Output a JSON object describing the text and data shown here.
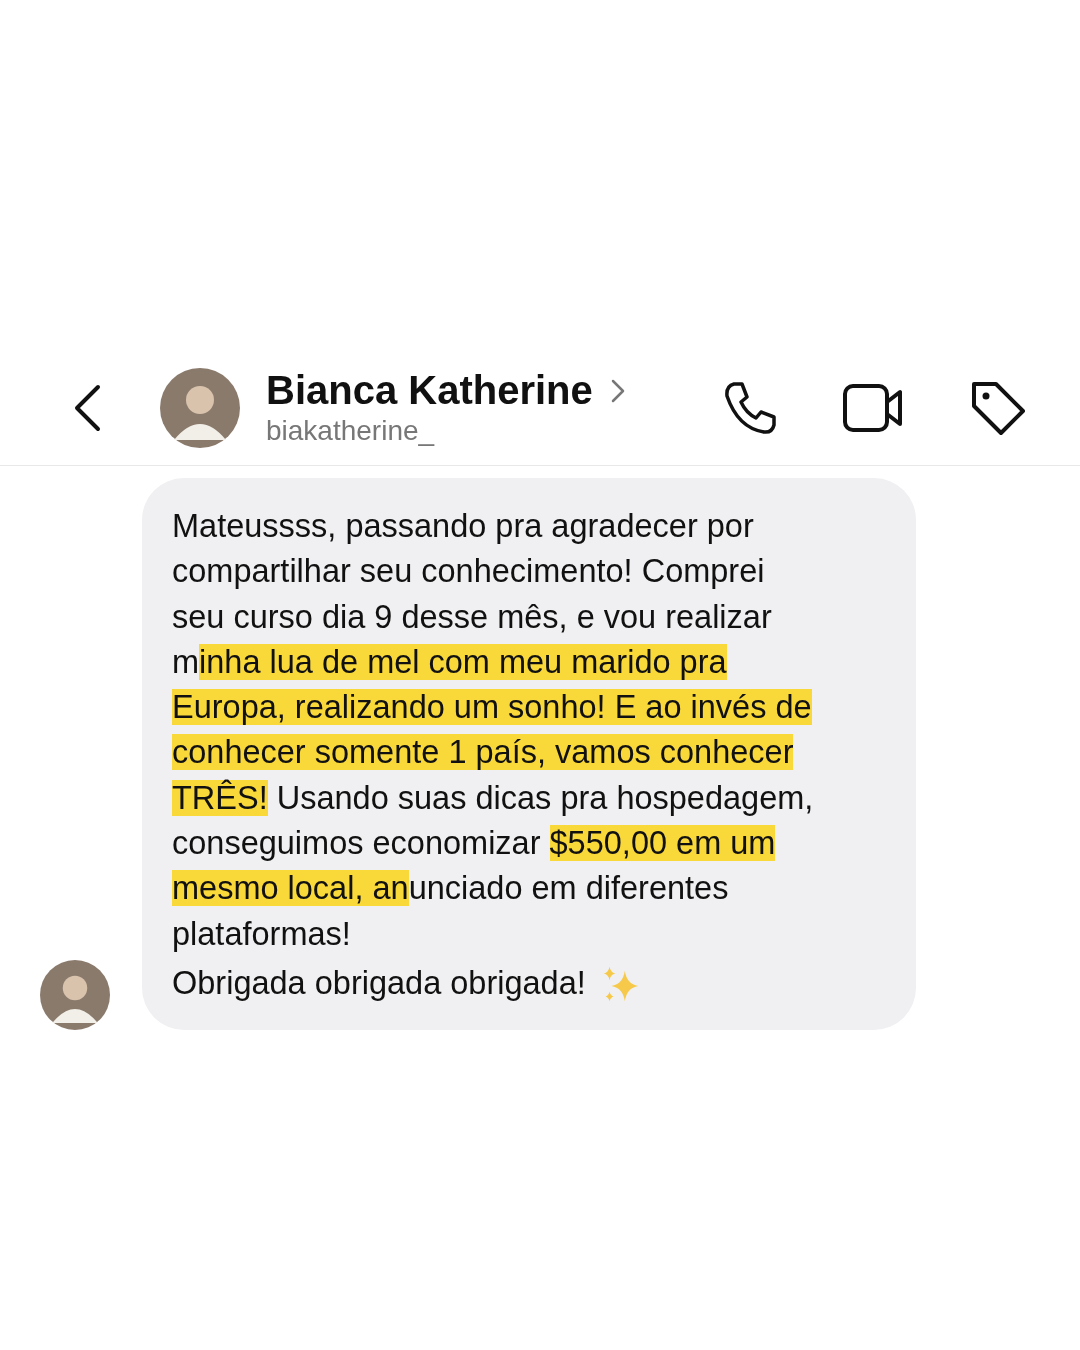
{
  "header": {
    "name": "Bianca Katherine",
    "username": "biakatherine_"
  },
  "message": {
    "lines": [
      {
        "segments": [
          {
            "text": "Mateussss, passando pra agradecer por",
            "highlighted": false
          }
        ]
      },
      {
        "segments": [
          {
            "text": "compartilhar seu conhecimento! Comprei",
            "highlighted": false
          }
        ]
      },
      {
        "segments": [
          {
            "text": "seu curso dia 9 desse mês, e vou realizar",
            "highlighted": false
          }
        ]
      },
      {
        "segments": [
          {
            "text": "m",
            "highlighted": false
          },
          {
            "text": "inha lua de mel com meu marido pra",
            "highlighted": true
          }
        ]
      },
      {
        "segments": [
          {
            "text": "Europa, realizando um sonho! E ao invés de",
            "highlighted": true
          }
        ]
      },
      {
        "segments": [
          {
            "text": "conhecer somente 1 país, vamos conhecer",
            "highlighted": true
          }
        ]
      },
      {
        "segments": [
          {
            "text": "TRÊS!",
            "highlighted": true
          },
          {
            "text": " Usando suas dicas pra hospedagem,",
            "highlighted": false
          }
        ]
      },
      {
        "segments": [
          {
            "text": "conseguimos economizar ",
            "highlighted": false
          },
          {
            "text": "$550,00 em um",
            "highlighted": true
          }
        ]
      },
      {
        "segments": [
          {
            "text": "mesmo local, an",
            "highlighted": true
          },
          {
            "text": "unciado em diferentes",
            "highlighted": false
          }
        ]
      },
      {
        "segments": [
          {
            "text": "plataformas!",
            "highlighted": false
          }
        ]
      }
    ],
    "closing": "Obrigada obrigada obrigada!"
  }
}
